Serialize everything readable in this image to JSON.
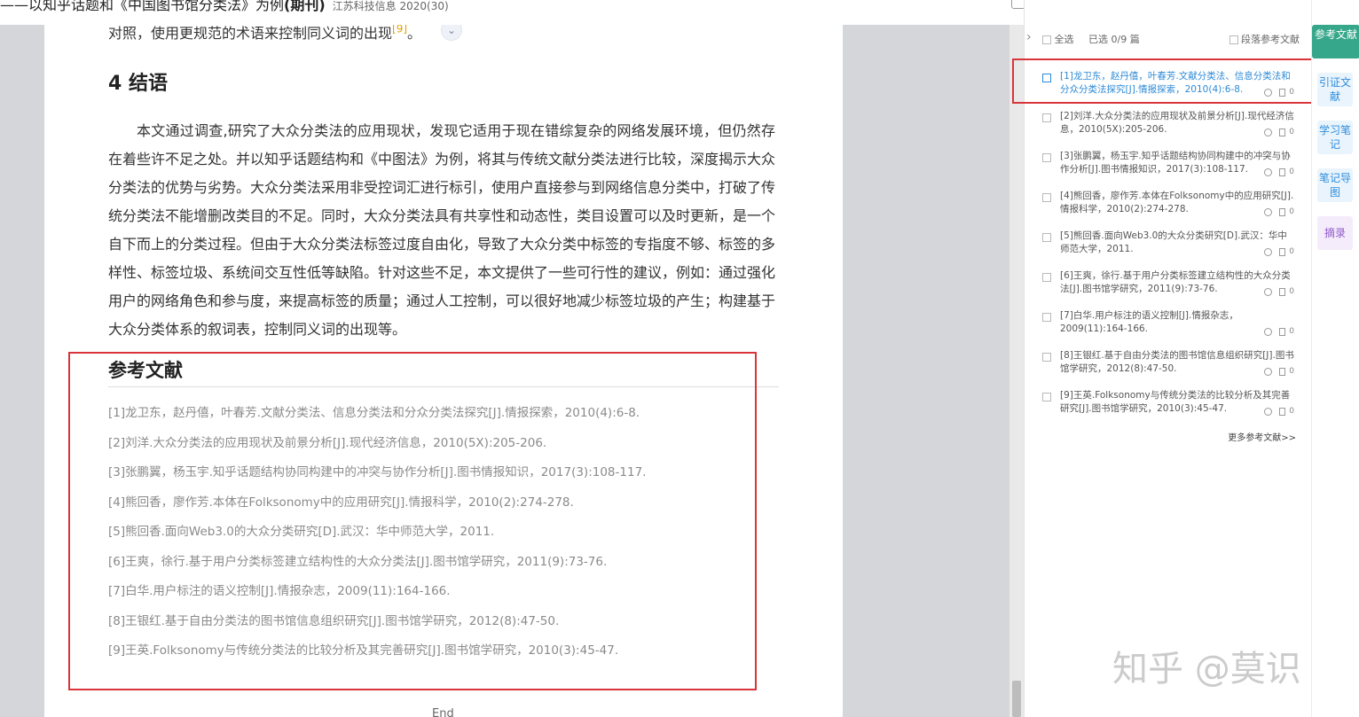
{
  "header": {
    "title_prefix": "——以知乎话题和《中国图书馆分类法》为例",
    "title_bold": "(期刊)",
    "source": "江苏科技信息 2020(30)"
  },
  "page": {
    "prev_line": "对照，使用更规范的术语来控制同义词的出现",
    "prev_line_ref": "[9]",
    "section_heading": "4 结语",
    "paragraph": "本文通过调查,研究了大众分类法的应用现状，发现它适用于现在错综复杂的网络发展环境，但仍然存在着些许不足之处。并以知乎话题结构和《中图法》为例，将其与传统文献分类法进行比较，深度揭示大众分类法的优势与劣势。大众分类法采用非受控词汇进行标引，使用户直接参与到网络信息分类中，打破了传统分类法不能增删改类目的不足。同时，大众分类法具有共享性和动态性，类目设置可以及时更新，是一个自下而上的分类过程。但由于大众分类法标签过度自由化，导致了大众分类中标签的专指度不够、标签的多样性、标签垃圾、系统间交互性低等缺陷。针对这些不足，本文提供了一些可行性的建议，例如：通过强化用户的网络角色和参与度，来提高标签的质量；通过人工控制，可以很好地减少标签垃圾的产生；构建基于大众分类体系的叙词表，控制同义词的出现等。",
    "refs_heading": "参考文献",
    "references": [
      "[1]龙卫东，赵丹僖，叶春芳.文献分类法、信息分类法和分众分类法探究[J].情报探索，2010(4):6-8.",
      "[2]刘洋.大众分类法的应用现状及前景分析[J].现代经济信息，2010(5X):205-206.",
      "[3]张鹏翼，杨玉宇.知乎话题结构协同构建中的冲突与协作分析[J].图书情报知识，2017(3):108-117.",
      "[4]熊回香，廖作芳.本体在Folksonomy中的应用研究[J].情报科学，2010(2):274-278.",
      "[5]熊回香.面向Web3.0的大众分类研究[D].武汉：华中师范大学，2011.",
      "[6]王爽，徐行.基于用户分类标签建立结构性的大众分类法[J].图书馆学研究，2011(9):73-76.",
      "[7]白华.用户标注的语义控制[J].情报杂志，2009(11):164-166.",
      "[8]王银红.基于自由分类法的图书馆信息组织研究[J].图书馆学研究，2012(8):47-50.",
      "[9]王英.Folksonomy与传统分类法的比较分析及其完善研究[J].图书馆学研究，2010(3):45-47."
    ],
    "end_label": "End"
  },
  "ref_panel": {
    "select_all": "全选",
    "selected_count": "已选 0/9 篇",
    "paragraph_refs": "段落参考文献",
    "items": [
      {
        "text": "[1]龙卫东，赵丹僖，叶春芳.文献分类法、信息分类法和分众分类法探究[J].情报探索，2010(4):6-8.",
        "count": "0"
      },
      {
        "text": "[2]刘洋.大众分类法的应用现状及前景分析[J].现代经济信息，2010(5X):205-206.",
        "count": "0"
      },
      {
        "text": "[3]张鹏翼，杨玉宇.知乎话题结构协同构建中的冲突与协作分析[J].图书情报知识，2017(3):108-117.",
        "count": "0"
      },
      {
        "text": "[4]熊回香，廖作芳.本体在Folksonomy中的应用研究[J].情报科学，2010(2):274-278.",
        "count": "0"
      },
      {
        "text": "[5]熊回香.面向Web3.0的大众分类研究[D].武汉：华中师范大学，2011.",
        "count": "0"
      },
      {
        "text": "[6]王爽，徐行.基于用户分类标签建立结构性的大众分类法[J].图书馆学研究，2011(9):73-76.",
        "count": "0"
      },
      {
        "text": "[7]白华.用户标注的语义控制[J].情报杂志，2009(11):164-166.",
        "count": "0"
      },
      {
        "text": "[8]王银红.基于自由分类法的图书馆信息组织研究[J].图书馆学研究，2012(8):47-50.",
        "count": "0"
      },
      {
        "text": "[9]王英.Folksonomy与传统分类法的比较分析及其完善研究[J].图书馆学研究，2010(3):45-47.",
        "count": "0"
      }
    ],
    "more_refs": "更多参考文献>>"
  },
  "right_tabs": {
    "references": "参考文献",
    "citations": "引证文献",
    "study_notes": "学习笔记",
    "note_map": "笔记导图",
    "excerpt": "摘录"
  },
  "watermark": "知乎 @莫识",
  "colors": {
    "highlight_red": "#d9343a",
    "link_blue": "#2d8ad6",
    "tab_green": "#36a78a",
    "tab_blue": "#2e8ddc",
    "tab_purple": "#8e58c9"
  }
}
